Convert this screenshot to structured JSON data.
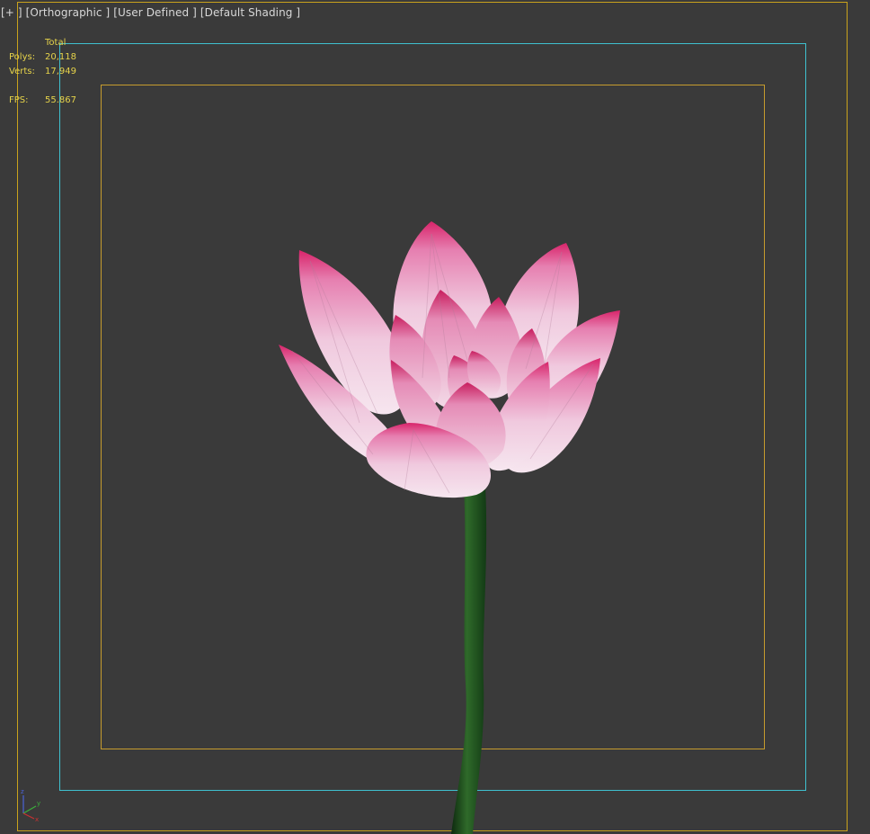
{
  "viewport": {
    "label_plus": "[+ ]",
    "label_view": "[Orthographic ]",
    "label_camera": "[User Defined ]",
    "label_shading": "[Default Shading ]"
  },
  "stats": {
    "total_label": "Total",
    "polys_label": "Polys:",
    "polys_value": "20,118",
    "verts_label": "Verts:",
    "verts_value": "17,949",
    "fps_label": "FPS:",
    "fps_value": "55.867"
  },
  "colors": {
    "background": "#3a3a3a",
    "outer_frame": "#c9a21c",
    "safe_frame": "#3fc1cf",
    "action_frame": "#c69c2e",
    "stats_text": "#e6d34a",
    "label_text": "#d8d8d8"
  },
  "axis_gizmo": {
    "z": "z",
    "y": "y",
    "x": "x"
  }
}
